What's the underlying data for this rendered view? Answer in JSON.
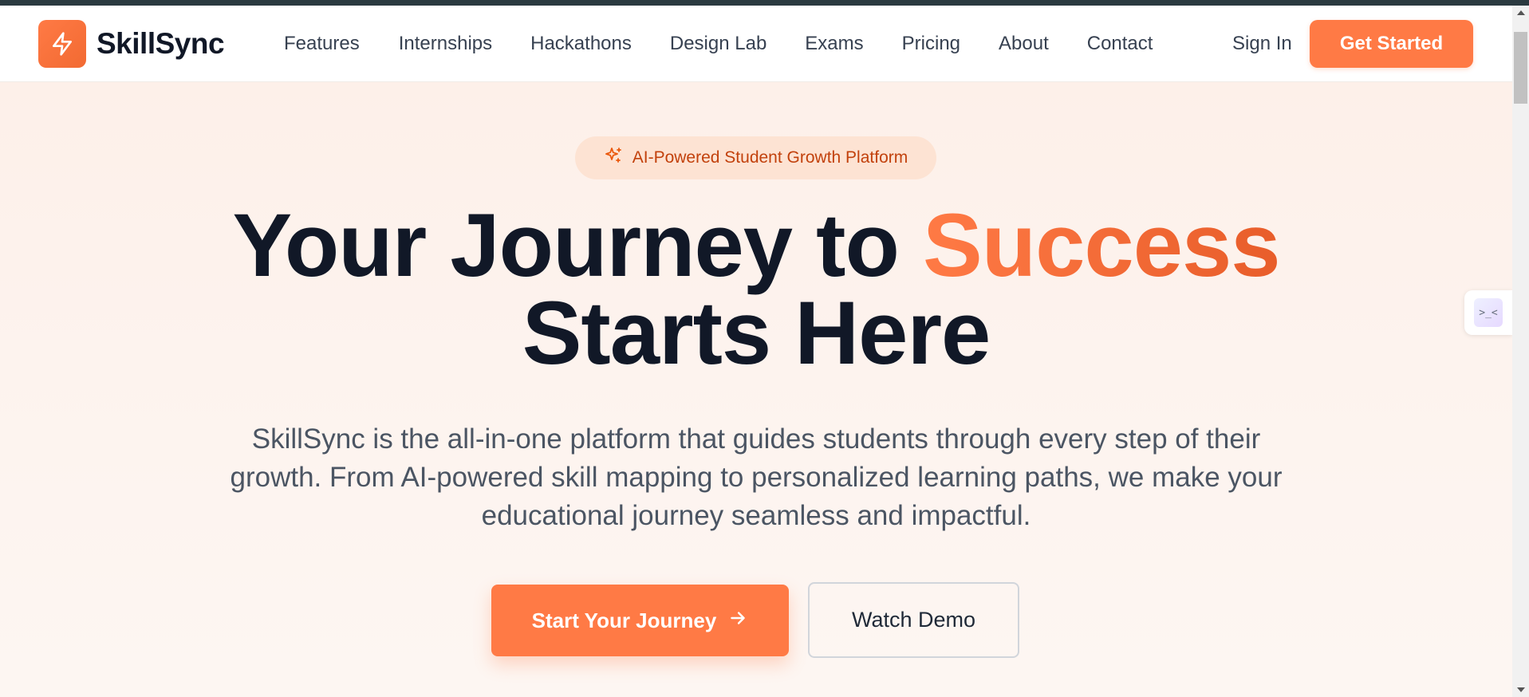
{
  "app": {
    "name": "SkillSync",
    "logo_icon": "lightning-bolt-icon",
    "accent_color": "#ff7a45"
  },
  "nav": {
    "links": [
      "Features",
      "Internships",
      "Hackathons",
      "Design Lab",
      "Exams",
      "Pricing",
      "About",
      "Contact"
    ],
    "sign_in": "Sign In",
    "cta": "Get Started"
  },
  "hero": {
    "badge": {
      "icon": "sparkles-icon",
      "text": "AI-Powered Student Growth Platform"
    },
    "headline_part1": "Your Journey to ",
    "headline_accent": "Success",
    "headline_line2": "Starts Here",
    "subtext": "SkillSync is the all-in-one platform that guides students through every step of their growth. From AI-powered skill mapping to personalized learning paths, we make your educational journey seamless and impactful.",
    "primary_cta": {
      "label": "Start Your Journey",
      "icon": "arrow-right-icon"
    },
    "secondary_cta": {
      "label": "Watch Demo"
    }
  },
  "widget": {
    "icon": "code-face-icon",
    "glyph": ">_<"
  }
}
